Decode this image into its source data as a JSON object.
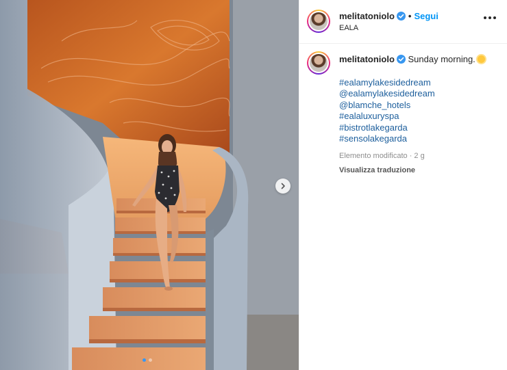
{
  "post": {
    "username": "melitatoniolo",
    "follow_label": "Segui",
    "separator": "•",
    "location": "EALA",
    "caption_text": "Sunday morning.",
    "hashtags": [
      "#ealamylakesidedream",
      "@ealamylakesidedream",
      "@blamche_hotels",
      "#ealaluxuryspa",
      "#bistrotlakegarda",
      "#sensolakegarda"
    ],
    "edited_label": "Elemento modificato · 2 g",
    "translate_label": "Visualizza traduzione"
  },
  "carousel": {
    "total": 2,
    "active_index": 0
  },
  "colors": {
    "accent": "#0095f6",
    "hashtag": "#1c5e9c",
    "muted": "#8e8e8e"
  },
  "icons": [
    "verified-badge-icon",
    "more-options-icon",
    "chevron-right-icon",
    "sun-emoji-icon"
  ]
}
